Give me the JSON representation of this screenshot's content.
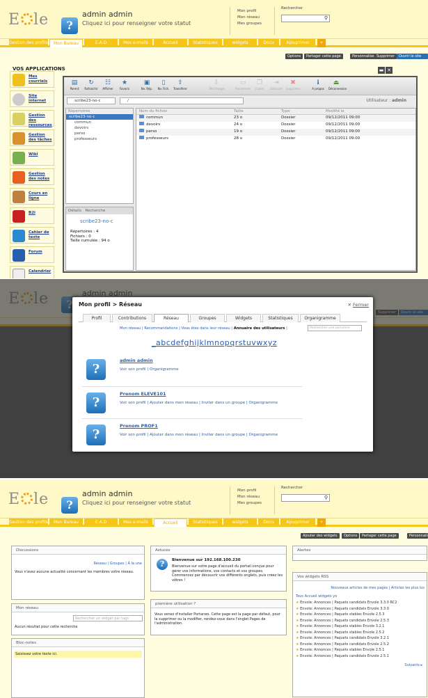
{
  "header": {
    "user_name": "admin admin",
    "user_status": "Cliquez ici pour renseigner votre statut",
    "links": [
      "Mon profil",
      "Mon réseau",
      "Mes groupes"
    ],
    "search_label": "Rechercher"
  },
  "tabs1": [
    "Gestion des profils",
    "Mon Bureau",
    "E.A.D",
    "Mes e-mails",
    "Accueil",
    "Statistiques",
    "widgets",
    "Docu",
    "Ajouprimer",
    "+"
  ],
  "actions1": [
    "Options",
    "Partager cette page",
    "Personnaliser",
    "Supprimer",
    "Ouvrir le site"
  ],
  "apps": {
    "title": "VOS APPLICATIONS",
    "items": [
      "Mes courriels",
      "Site internet",
      "Gestion des ressources",
      "Gestion des tâches",
      "Wiki",
      "Gestion des notes",
      "Cours en ligne",
      "B2i",
      "Cahier de texte",
      "Forum",
      "Calendrier"
    ]
  },
  "fm": {
    "toolbar": [
      "Parent",
      "Rafraichir",
      "Afficher",
      "Favoris",
      "Nv. Rép.",
      "Nv. Fich.",
      "Transférer",
      "Télécharger",
      "Renommer",
      "Copier",
      "Déplacer",
      "Supprimer",
      "A propos",
      "Déconnexion"
    ],
    "current_dir": "scribe23-no-c",
    "path": "/",
    "user_label": "Utilisateur :",
    "user_name": "admin",
    "tree_header": "Répertoires",
    "tree_root": "scribe23-no-c",
    "tree_children": [
      "commun",
      "devoirs",
      "perso",
      "professeurs"
    ],
    "details_tab": "Détails",
    "search_tab": "Recherche",
    "details_name": "scribe23-no-c",
    "details_lines": [
      "Répertoires : 4",
      "Fichiers : 0",
      "Taille cumulée : 94 o"
    ],
    "columns": [
      "Nom du fichier",
      "Taille",
      "Type",
      "Modifié le"
    ],
    "rows": [
      [
        "commun",
        "23 o",
        "Dossier",
        "09/12/2011 09:00"
      ],
      [
        "devoirs",
        "24 o",
        "Dossier",
        "09/12/2011 09:00"
      ],
      [
        "perso",
        "19 o",
        "Dossier",
        "09/12/2011 09:00"
      ],
      [
        "professeurs",
        "28 o",
        "Dossier",
        "09/12/2011 09:00"
      ]
    ]
  },
  "modal": {
    "title": "Mon profil > Réseau",
    "close": "Fermer",
    "tabs": [
      "Profil",
      "Contributions",
      "Réseau",
      "Groupes",
      "Widgets",
      "Statistiques",
      "Organigramme"
    ],
    "sublinks": "Mon réseau | Recommandations | Vous êtes dans leur réseau |",
    "sublink_active": "Annuaire des utilisateurs",
    "search_placeholder": "Rechercher une personne",
    "alphabet": "_abcdefghijklmnopqrstuvwxyz",
    "people": [
      {
        "name": "admin admin",
        "links": "Voir son profil | Organigramme"
      },
      {
        "name": "Prenom ELEVE101",
        "links": "Voir son profil | Ajouter dans mon réseau | Inviter dans un groupe | Organigramme"
      },
      {
        "name": "Prenom PROF1",
        "links": "Voir son profil | Ajouter dans mon réseau | Inviter dans un groupe | Organigramme"
      }
    ]
  },
  "tabs3": [
    "Gestion des profils",
    "Mon Bureau",
    "E.A.D",
    "Mes e-mails",
    "Accueil",
    "Statistiques",
    "widgets",
    "Docu",
    "Ajouprimer",
    "+"
  ],
  "actions3": [
    "Ajouter des widgets",
    "Options",
    "Partager cette page",
    "Personnaliser"
  ],
  "widgets": {
    "discussions_title": "Discussions",
    "discussions_links": "Réseau | Groupes | À la une",
    "discussions_text": "Vous n'avez aucune actualité concernant les membres votre réseau.",
    "reseau_title": "Mon réseau",
    "reseau_placeholder": "Rechercher un widget par tags",
    "reseau_text": "Aucun résultat pour cette recherche",
    "bloc_title": "Bloc-notes",
    "bloc_text": "Saisissez votre texte ici.",
    "astuces_title": "Astuces",
    "astuces_heading": "Bienvenue sur 192.168.100.230",
    "astuces_text": "Bienvenue sur votre page d'accueil du portail conçue pour gérer vos informations, vos contacts et vos groupes. Commencez par découvrir vos différents onglets, puis créez les vôtres !",
    "premiere_title": "première utilisation ?",
    "premiere_text": "Vous venez d'installer Portaneo. Cette page est la page par défaut, pour la supprimer ou la modifier, rendez-vous dans l'onglet Pages de l'administration.",
    "alertes_title": "Alertes",
    "rss_title": "Vos widgets RSS",
    "rss_header": "Nouveaux articles de mes pages | Articles les plus lus",
    "rss_filter": "Tous Accueil widgets yo",
    "rss_items": [
      "Envole: Annonces | Paquets candidats Envole 3.3.0 RC2",
      "Envole: Annonces | Paquets candidats Envole 3.3.0",
      "Envole: Annonces | Paquets stables Envole 2.5.3",
      "Envole: Annonces | Paquets candidats Envole 2.5.3",
      "Envole: Annonces | Paquets stables Envole 3.2.1",
      "Envole: Annonces | Paquets stables Envole 2.5.2",
      "Envole: Annonces | Paquets candidats Envole 3.2.1",
      "Envole: Annonces | Paquets candidats Envole 2.5.2",
      "Envole: Annonces | Paquets stables Envole 2.5.1",
      "Envole: Annonces | Paquets candidats Envole 2.5.1"
    ],
    "rss_next": "Suivants"
  },
  "colors": {
    "accent": "#f5c518",
    "link": "#2a5fb0",
    "header_bg": "#fff9c8"
  }
}
